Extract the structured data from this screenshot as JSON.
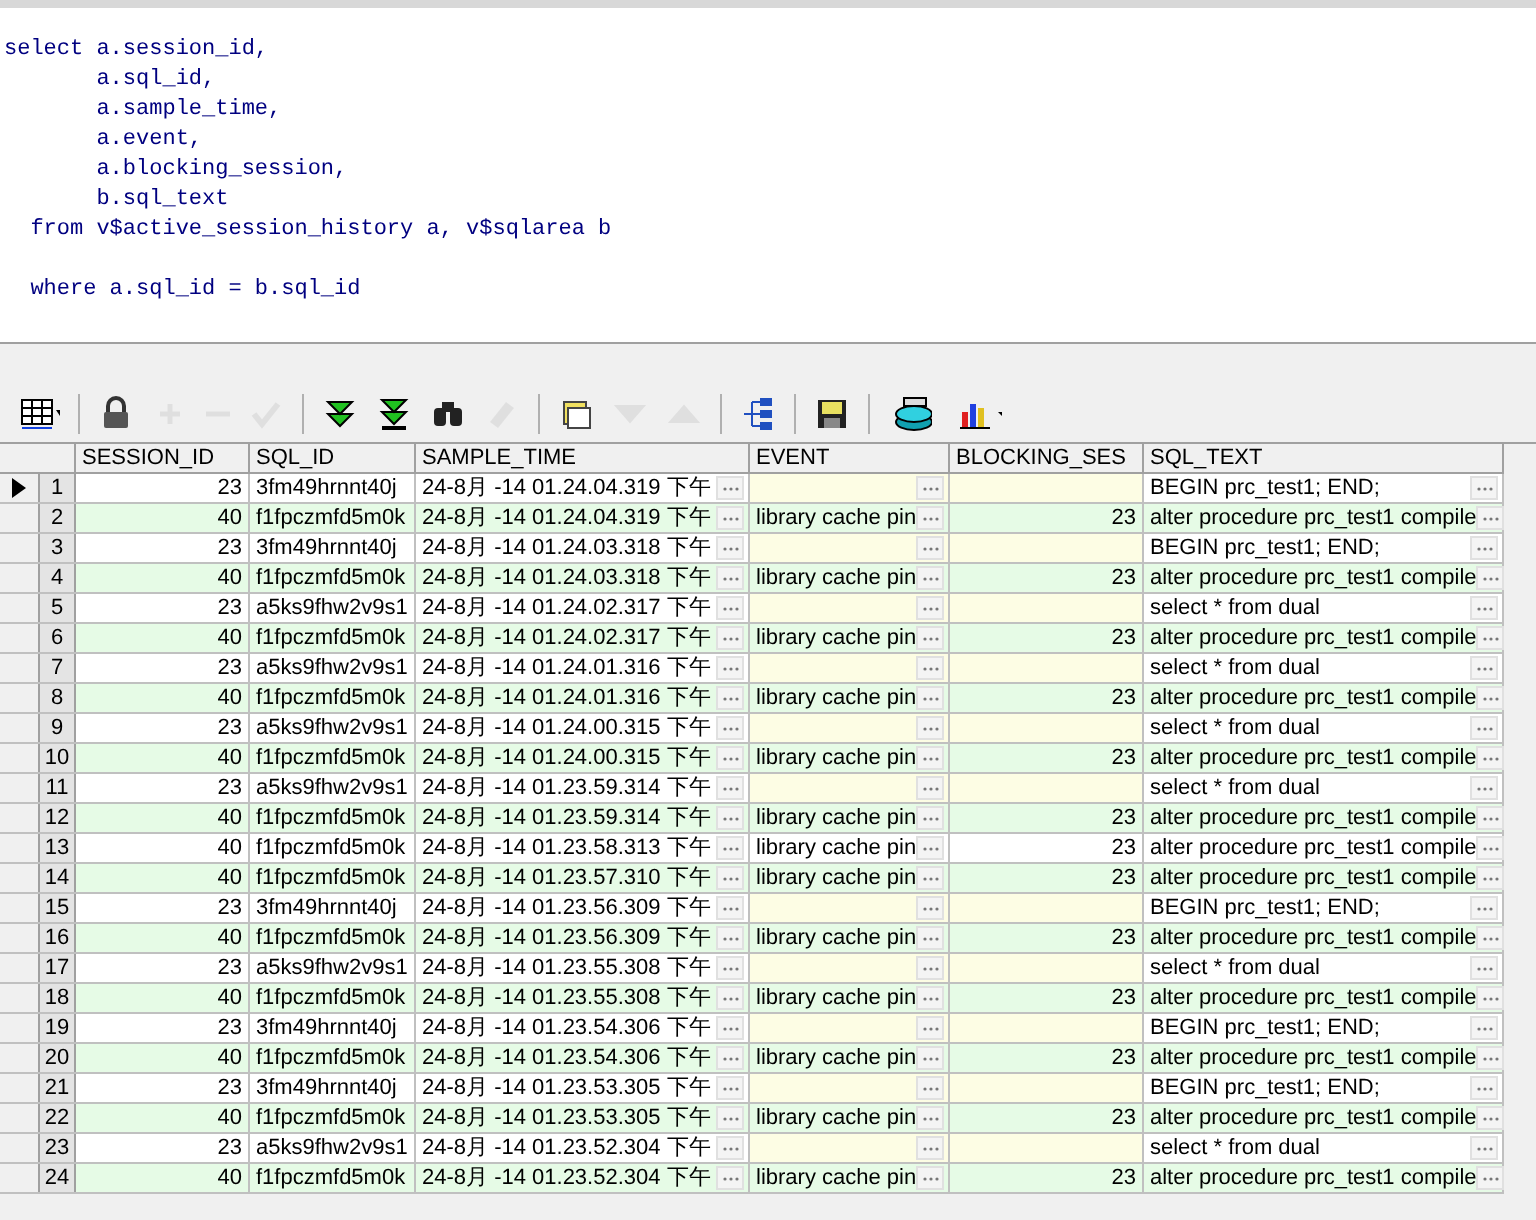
{
  "editor": {
    "lines": [
      {
        "text": "select a.session_id,",
        "gap_before": false
      },
      {
        "text": "       a.sql_id,",
        "gap_before": false
      },
      {
        "text": "       a.sample_time,",
        "gap_before": false
      },
      {
        "text": "       a.event,",
        "gap_before": false
      },
      {
        "text": "       a.blocking_session,",
        "gap_before": false
      },
      {
        "text": "       b.sql_text",
        "gap_before": false
      },
      {
        "text": "  from v$active_session_history a, v$sqlarea b",
        "gap_before": false
      },
      {
        "text": "  where a.sql_id = b.sql_id",
        "gap_before": true
      }
    ]
  },
  "toolbar": [
    {
      "kind": "grid",
      "disabled": false
    },
    {
      "kind": "lock",
      "disabled": false
    },
    {
      "kind": "plus",
      "disabled": true
    },
    {
      "kind": "minus",
      "disabled": true
    },
    {
      "kind": "check",
      "disabled": true
    },
    {
      "kind": "down-all",
      "disabled": false
    },
    {
      "kind": "down-last",
      "disabled": false
    },
    {
      "kind": "find",
      "disabled": false
    },
    {
      "kind": "eraser",
      "disabled": true
    },
    {
      "kind": "stack",
      "disabled": false
    },
    {
      "kind": "tri-down",
      "disabled": true
    },
    {
      "kind": "tri-up",
      "disabled": true
    },
    {
      "kind": "tree",
      "disabled": false
    },
    {
      "kind": "save",
      "disabled": false
    },
    {
      "kind": "database",
      "disabled": false
    },
    {
      "kind": "chart",
      "disabled": false
    }
  ],
  "table": {
    "columns": [
      "SESSION_ID",
      "SQL_ID",
      "SAMPLE_TIME",
      "EVENT",
      "BLOCKING_SES",
      "SQL_TEXT"
    ],
    "rows": [
      {
        "num": "1",
        "selected": true,
        "session_id": "23",
        "sql_id": "3fm49hrnnt40j",
        "sample_time": "24-8月 -14 01.24.04.319 下午",
        "sql_text": "BEGIN prc_test1; END;"
      },
      {
        "num": "2",
        "selected": false,
        "session_id": "40",
        "sql_id": "f1fpczmfd5m0k",
        "sample_time": "24-8月 -14 01.24.04.319 下午",
        "event": "library cache pin",
        "blocking": "23",
        "sql_text": "alter procedure prc_test1 compile"
      },
      {
        "num": "3",
        "selected": false,
        "session_id": "23",
        "sql_id": "3fm49hrnnt40j",
        "sample_time": "24-8月 -14 01.24.03.318 下午",
        "sql_text": "BEGIN prc_test1; END;"
      },
      {
        "num": "4",
        "selected": false,
        "session_id": "40",
        "sql_id": "f1fpczmfd5m0k",
        "sample_time": "24-8月 -14 01.24.03.318 下午",
        "event": "library cache pin",
        "blocking": "23",
        "sql_text": "alter procedure prc_test1 compile"
      },
      {
        "num": "5",
        "selected": false,
        "session_id": "23",
        "sql_id": "a5ks9fhw2v9s1",
        "sample_time": "24-8月 -14 01.24.02.317 下午",
        "sql_text": "select * from dual"
      },
      {
        "num": "6",
        "selected": false,
        "session_id": "40",
        "sql_id": "f1fpczmfd5m0k",
        "sample_time": "24-8月 -14 01.24.02.317 下午",
        "event": "library cache pin",
        "blocking": "23",
        "sql_text": "alter procedure prc_test1 compile"
      },
      {
        "num": "7",
        "selected": false,
        "session_id": "23",
        "sql_id": "a5ks9fhw2v9s1",
        "sample_time": "24-8月 -14 01.24.01.316 下午",
        "sql_text": "select * from dual"
      },
      {
        "num": "8",
        "selected": false,
        "session_id": "40",
        "sql_id": "f1fpczmfd5m0k",
        "sample_time": "24-8月 -14 01.24.01.316 下午",
        "event": "library cache pin",
        "blocking": "23",
        "sql_text": "alter procedure prc_test1 compile"
      },
      {
        "num": "9",
        "selected": false,
        "session_id": "23",
        "sql_id": "a5ks9fhw2v9s1",
        "sample_time": "24-8月 -14 01.24.00.315 下午",
        "sql_text": "select * from dual"
      },
      {
        "num": "10",
        "selected": false,
        "session_id": "40",
        "sql_id": "f1fpczmfd5m0k",
        "sample_time": "24-8月 -14 01.24.00.315 下午",
        "event": "library cache pin",
        "blocking": "23",
        "sql_text": "alter procedure prc_test1 compile"
      },
      {
        "num": "11",
        "selected": false,
        "session_id": "23",
        "sql_id": "a5ks9fhw2v9s1",
        "sample_time": "24-8月 -14 01.23.59.314 下午",
        "sql_text": "select * from dual"
      },
      {
        "num": "12",
        "selected": false,
        "session_id": "40",
        "sql_id": "f1fpczmfd5m0k",
        "sample_time": "24-8月 -14 01.23.59.314 下午",
        "event": "library cache pin",
        "blocking": "23",
        "sql_text": "alter procedure prc_test1 compile"
      },
      {
        "num": "13",
        "selected": false,
        "session_id": "40",
        "sql_id": "f1fpczmfd5m0k",
        "sample_time": "24-8月 -14 01.23.58.313 下午",
        "event": "library cache pin",
        "blocking": "23",
        "sql_text": "alter procedure prc_test1 compile"
      },
      {
        "num": "14",
        "selected": false,
        "session_id": "40",
        "sql_id": "f1fpczmfd5m0k",
        "sample_time": "24-8月 -14 01.23.57.310 下午",
        "event": "library cache pin",
        "blocking": "23",
        "sql_text": "alter procedure prc_test1 compile"
      },
      {
        "num": "15",
        "selected": false,
        "session_id": "23",
        "sql_id": "3fm49hrnnt40j",
        "sample_time": "24-8月 -14 01.23.56.309 下午",
        "sql_text": "BEGIN prc_test1; END;"
      },
      {
        "num": "16",
        "selected": false,
        "session_id": "40",
        "sql_id": "f1fpczmfd5m0k",
        "sample_time": "24-8月 -14 01.23.56.309 下午",
        "event": "library cache pin",
        "blocking": "23",
        "sql_text": "alter procedure prc_test1 compile"
      },
      {
        "num": "17",
        "selected": false,
        "session_id": "23",
        "sql_id": "a5ks9fhw2v9s1",
        "sample_time": "24-8月 -14 01.23.55.308 下午",
        "sql_text": "select * from dual"
      },
      {
        "num": "18",
        "selected": false,
        "session_id": "40",
        "sql_id": "f1fpczmfd5m0k",
        "sample_time": "24-8月 -14 01.23.55.308 下午",
        "event": "library cache pin",
        "blocking": "23",
        "sql_text": "alter procedure prc_test1 compile"
      },
      {
        "num": "19",
        "selected": false,
        "session_id": "23",
        "sql_id": "3fm49hrnnt40j",
        "sample_time": "24-8月 -14 01.23.54.306 下午",
        "sql_text": "BEGIN prc_test1; END;"
      },
      {
        "num": "20",
        "selected": false,
        "session_id": "40",
        "sql_id": "f1fpczmfd5m0k",
        "sample_time": "24-8月 -14 01.23.54.306 下午",
        "event": "library cache pin",
        "blocking": "23",
        "sql_text": "alter procedure prc_test1 compile"
      },
      {
        "num": "21",
        "selected": false,
        "session_id": "23",
        "sql_id": "3fm49hrnnt40j",
        "sample_time": "24-8月 -14 01.23.53.305 下午",
        "sql_text": "BEGIN prc_test1; END;"
      },
      {
        "num": "22",
        "selected": false,
        "session_id": "40",
        "sql_id": "f1fpczmfd5m0k",
        "sample_time": "24-8月 -14 01.23.53.305 下午",
        "event": "library cache pin",
        "blocking": "23",
        "sql_text": "alter procedure prc_test1 compile"
      },
      {
        "num": "23",
        "selected": false,
        "session_id": "23",
        "sql_id": "a5ks9fhw2v9s1",
        "sample_time": "24-8月 -14 01.23.52.304 下午",
        "sql_text": "select * from dual"
      },
      {
        "num": "24",
        "selected": false,
        "session_id": "40",
        "sql_id": "f1fpczmfd5m0k",
        "sample_time": "24-8月 -14 01.23.52.304 下午",
        "event": "library cache pin",
        "blocking": "23",
        "sql_text": "alter procedure prc_test1 compile"
      }
    ]
  }
}
